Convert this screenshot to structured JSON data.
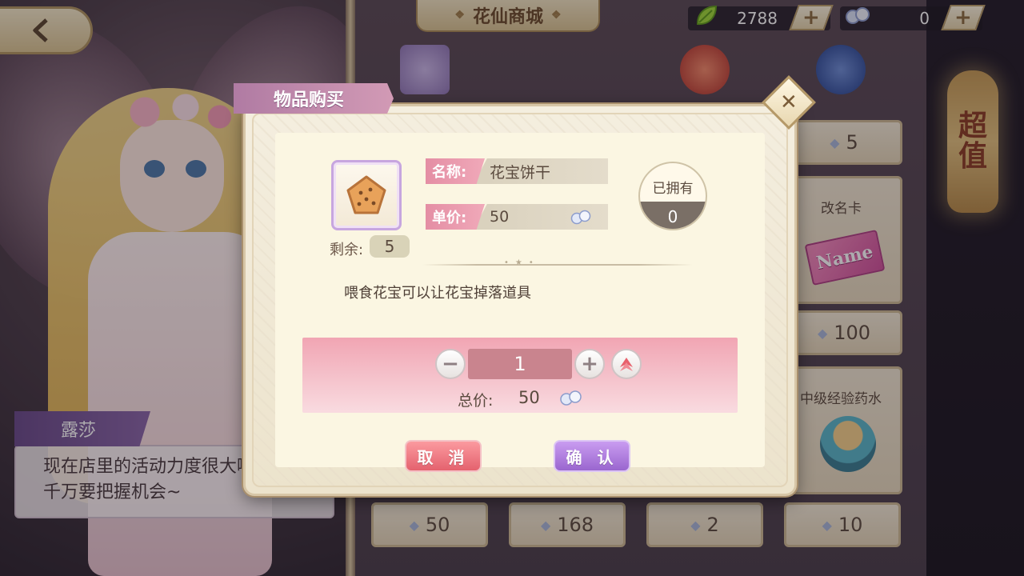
{
  "header": {
    "back_icon": "back-arrow-icon",
    "title": "花仙商城"
  },
  "currencies": [
    {
      "icon": "leaf-icon",
      "value": "2788",
      "add": "+"
    },
    {
      "icon": "diamond-icon",
      "value": "0",
      "add": "+"
    }
  ],
  "side_banner": {
    "text_1": "超",
    "text_2": "值"
  },
  "shop": {
    "prices": [
      "5",
      "100",
      "50",
      "168",
      "2",
      "10"
    ],
    "item_names": [
      "改名卡",
      "中级经验药水"
    ],
    "name_card_text": "Name"
  },
  "npc": {
    "name": "露莎",
    "line_1": "现在店里的活动力度很大哟!",
    "line_2": "千万要把握机会~"
  },
  "dialog": {
    "title": "物品购买",
    "close": "✕",
    "remain_label": "剩余:",
    "remain_value": "5",
    "name_label": "名称:",
    "name_value": "花宝饼干",
    "price_label": "单价:",
    "price_value": "50",
    "owned_label": "已拥有",
    "owned_value": "0",
    "description": "喂食花宝可以让花宝掉落道具",
    "quantity": "1",
    "minus": "−",
    "plus": "+",
    "total_label": "总价:",
    "total_value": "50",
    "cancel": "取 消",
    "confirm": "确 认"
  },
  "colors": {
    "accent_pink": "#e48ea4",
    "confirm_purple": "#9a66cf",
    "cancel_red": "#e4626e",
    "panel_cream": "#fbf6e2"
  }
}
